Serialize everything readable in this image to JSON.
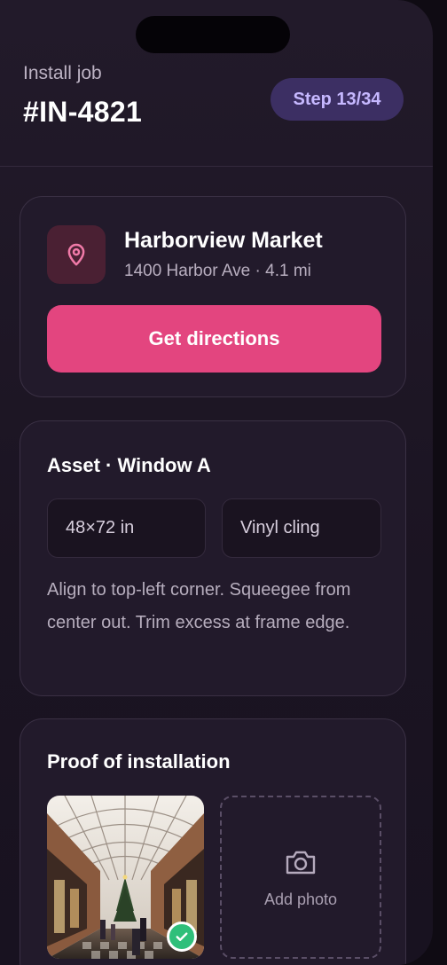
{
  "header": {
    "eyebrow": "Install job",
    "job_id": "#IN-4821",
    "step": "Step 13/34"
  },
  "location": {
    "icon": "map-pin-icon",
    "name": "Harborview Market",
    "address": "1400 Harbor Ave · 4.1 mi",
    "directions_label": "Get directions"
  },
  "asset": {
    "title": "Asset · Window A",
    "size": "48×72 in",
    "material": "Vinyl cling",
    "notes": "Align to top-left corner. Squeegee from center out. Trim excess at frame edge."
  },
  "proof": {
    "title": "Proof of installation",
    "photo_status": "verified",
    "add_photo_label": "Add photo",
    "add_photo_icon": "camera-icon"
  },
  "colors": {
    "accent": "#e3457f",
    "step_badge_bg": "#3c2f63",
    "step_badge_text": "#c6b8ff",
    "check": "#2fbf7a"
  }
}
